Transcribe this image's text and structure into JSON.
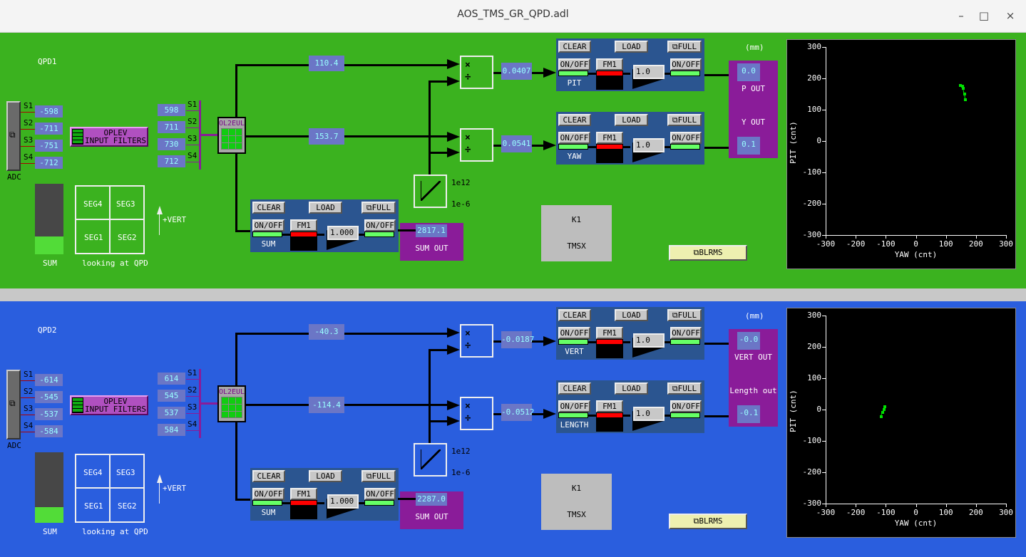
{
  "window": {
    "title": "AOS_TMS_GR_QPD.adl",
    "minimize": "–",
    "maximize": "□",
    "close": "×"
  },
  "common": {
    "adc": "ADC",
    "oplev": "OPLEV\nINPUT FILTERS",
    "ol2eul": "OL2EUL",
    "sum": "SUM",
    "looking": "looking at QPD",
    "segs": [
      "SEG4",
      "SEG3",
      "SEG1",
      "SEG2"
    ],
    "vert": "+VERT",
    "sat_hi": "1e12",
    "sat_lo": "1e-6",
    "clear": "CLEAR",
    "load": "LOAD",
    "full": "FULL",
    "onoff": "ON/OFF",
    "fm1": "FM1",
    "sum_out": "SUM OUT",
    "mm": "(mm)",
    "k1": "K1",
    "tmsx": "TMSX",
    "blrms": "BLRMS",
    "sensors": [
      "S1",
      "S2",
      "S3",
      "S4"
    ],
    "ylabel": "PIT (cnt)",
    "xlabel": "YAW (cnt)",
    "ticks": [
      "-300",
      "-200",
      "-100",
      "0",
      "100",
      "200",
      "300"
    ]
  },
  "colors": {
    "panel1": "#3bb21f",
    "panel2": "#2a5ede",
    "value_box": "#6b76c6",
    "filter_module": "#2b5590",
    "output": "#8a1c99",
    "trace": "#00e000"
  },
  "panels": [
    {
      "name": "QPD1",
      "adc": [
        "-598",
        "-711",
        "-751",
        "-712"
      ],
      "seg": [
        "598",
        "711",
        "730",
        "712"
      ],
      "dof1": "110.4",
      "dof2": "153.7",
      "norm1": "0.0407",
      "norm2": "0.0541",
      "fm1_label": "PIT",
      "fm2_label": "YAW",
      "gain1": "1.0",
      "gain2": "1.0",
      "sum_gain": "1.000",
      "sum_val": "2817.1",
      "out1": "0.0",
      "out2": "0.1",
      "out1_label": "P OUT",
      "out2_label": "Y OUT",
      "sum_fill": 0.25,
      "chart_data": {
        "type": "scatter",
        "xlabel": "YAW (cnt)",
        "ylabel": "PIT (cnt)",
        "xlim": [
          -300,
          300
        ],
        "ylim": [
          -300,
          300
        ],
        "points": [
          [
            148,
            178
          ],
          [
            155,
            176
          ],
          [
            158,
            168
          ],
          [
            162,
            150
          ],
          [
            165,
            132
          ]
        ]
      }
    },
    {
      "name": "QPD2",
      "adc": [
        "-614",
        "-545",
        "-537",
        "-584"
      ],
      "seg": [
        "614",
        "545",
        "537",
        "584"
      ],
      "dof1": "-40.3",
      "dof2": "-114.4",
      "norm1": "-0.0187",
      "norm2": "-0.0512",
      "fm1_label": "VERT",
      "fm2_label": "LENGTH",
      "gain1": "1.0",
      "gain2": "1.0",
      "sum_gain": "1.000",
      "sum_val": "2287.0",
      "out1": "-0.0",
      "out2": "-0.1",
      "out1_label": "VERT OUT",
      "out2_label": "Length out",
      "sum_fill": 0.22,
      "chart_data": {
        "type": "scatter",
        "xlabel": "YAW (cnt)",
        "ylabel": "PIT (cnt)",
        "xlim": [
          -300,
          300
        ],
        "ylim": [
          -300,
          300
        ],
        "points": [
          [
            -103,
            8
          ],
          [
            -106,
            0
          ],
          [
            -110,
            -10
          ],
          [
            -115,
            -22
          ]
        ]
      }
    }
  ]
}
